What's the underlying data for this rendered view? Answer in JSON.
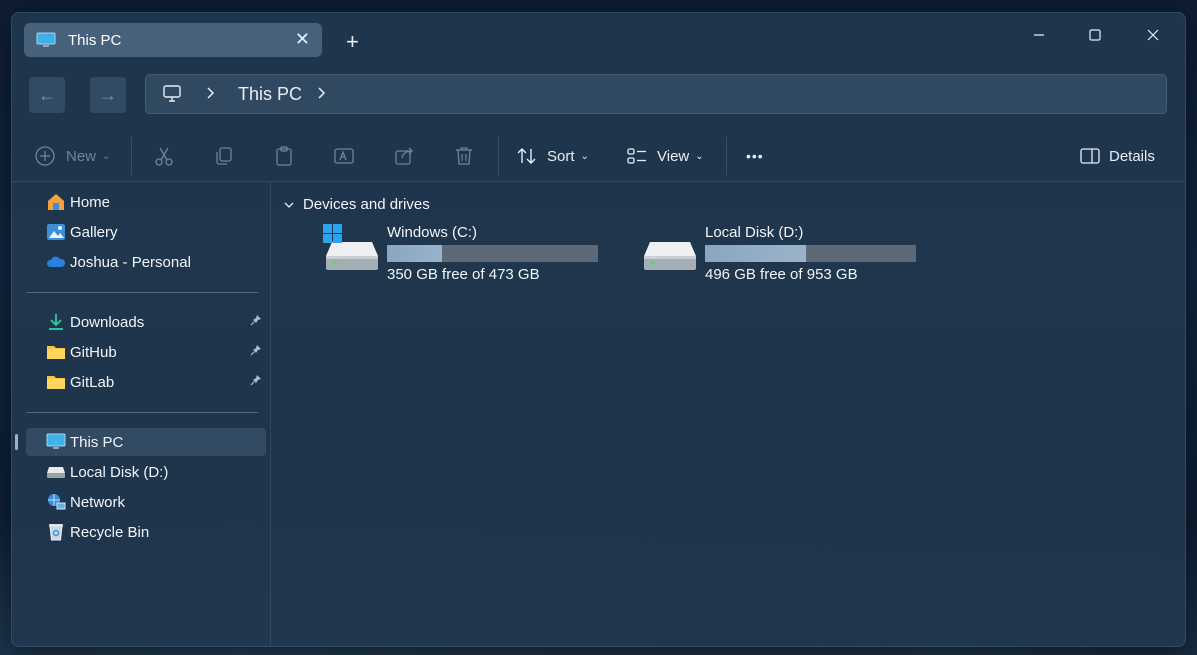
{
  "window": {
    "tab_title": "This PC",
    "new_tab": "+",
    "minimize": "—",
    "maximize": "☐",
    "close": "✕"
  },
  "nav": {
    "back": "←",
    "forward": "→",
    "breadcrumb": [
      "This PC"
    ]
  },
  "toolbar": {
    "new_label": "New",
    "sort_label": "Sort",
    "view_label": "View",
    "more_label": "•••",
    "details_label": "Details"
  },
  "sidebar": {
    "quick": [
      {
        "label": "Home",
        "icon": "home-icon"
      },
      {
        "label": "Gallery",
        "icon": "gallery-icon"
      },
      {
        "label": "Joshua - Personal",
        "icon": "onedrive-icon"
      }
    ],
    "pinned": [
      {
        "label": "Downloads",
        "icon": "downloads-icon"
      },
      {
        "label": "GitHub",
        "icon": "folder-icon"
      },
      {
        "label": "GitLab",
        "icon": "folder-icon"
      }
    ],
    "locations": [
      {
        "label": "This PC",
        "icon": "this-pc-icon"
      },
      {
        "label": "Local Disk (D:)",
        "icon": "drive-icon"
      },
      {
        "label": "Network",
        "icon": "network-icon"
      },
      {
        "label": "Recycle Bin",
        "icon": "recycle-bin-icon"
      }
    ]
  },
  "main": {
    "group_title": "Devices and drives",
    "drives": [
      {
        "name": "Windows (C:)",
        "free_text": "350 GB free of 473 GB",
        "used_fraction": 0.26
      },
      {
        "name": "Local Disk (D:)",
        "free_text": "496 GB free of 953 GB",
        "used_fraction": 0.48
      }
    ]
  }
}
